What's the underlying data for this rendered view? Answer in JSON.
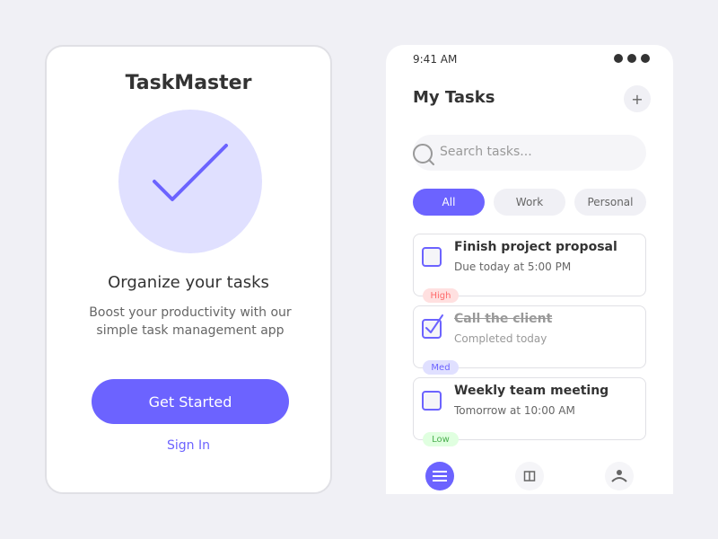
{
  "onboarding": {
    "app_name": "TaskMaster",
    "hero_icon": "checkmark-icon",
    "title": "Organize your tasks",
    "description": "Boost your productivity with our simple task management app",
    "primary_button": "Get Started",
    "secondary_link": "Sign In"
  },
  "phone": {
    "status_time": "9:41 AM",
    "title": "My Tasks",
    "add_label": "+",
    "search_placeholder": "Search tasks...",
    "filters": [
      {
        "label": "All",
        "active": true
      },
      {
        "label": "Work",
        "active": false
      },
      {
        "label": "Personal",
        "active": false
      }
    ],
    "tasks": [
      {
        "title": "Finish project proposal",
        "subtitle": "Due today at 5:00 PM",
        "priority": "High",
        "completed": false
      },
      {
        "title": "Call the client",
        "subtitle": "Completed today",
        "priority": "Med",
        "completed": true
      },
      {
        "title": "Weekly team meeting",
        "subtitle": "Tomorrow at 10:00 AM",
        "priority": "Low",
        "completed": false
      }
    ],
    "nav": [
      {
        "icon": "list-icon",
        "active": true
      },
      {
        "icon": "calendar-icon",
        "active": false
      },
      {
        "icon": "profile-icon",
        "active": false
      }
    ]
  },
  "colors": {
    "accent": "#6c63ff",
    "hero_bg": "#e0e0ff",
    "page_bg": "#f0f0f5",
    "priority_high_bg": "#ffe0e0",
    "priority_high_text": "#ff6b6b",
    "priority_med_bg": "#e0e0ff",
    "priority_med_text": "#6c63ff",
    "priority_low_bg": "#e0ffe0",
    "priority_low_text": "#4caf50"
  }
}
